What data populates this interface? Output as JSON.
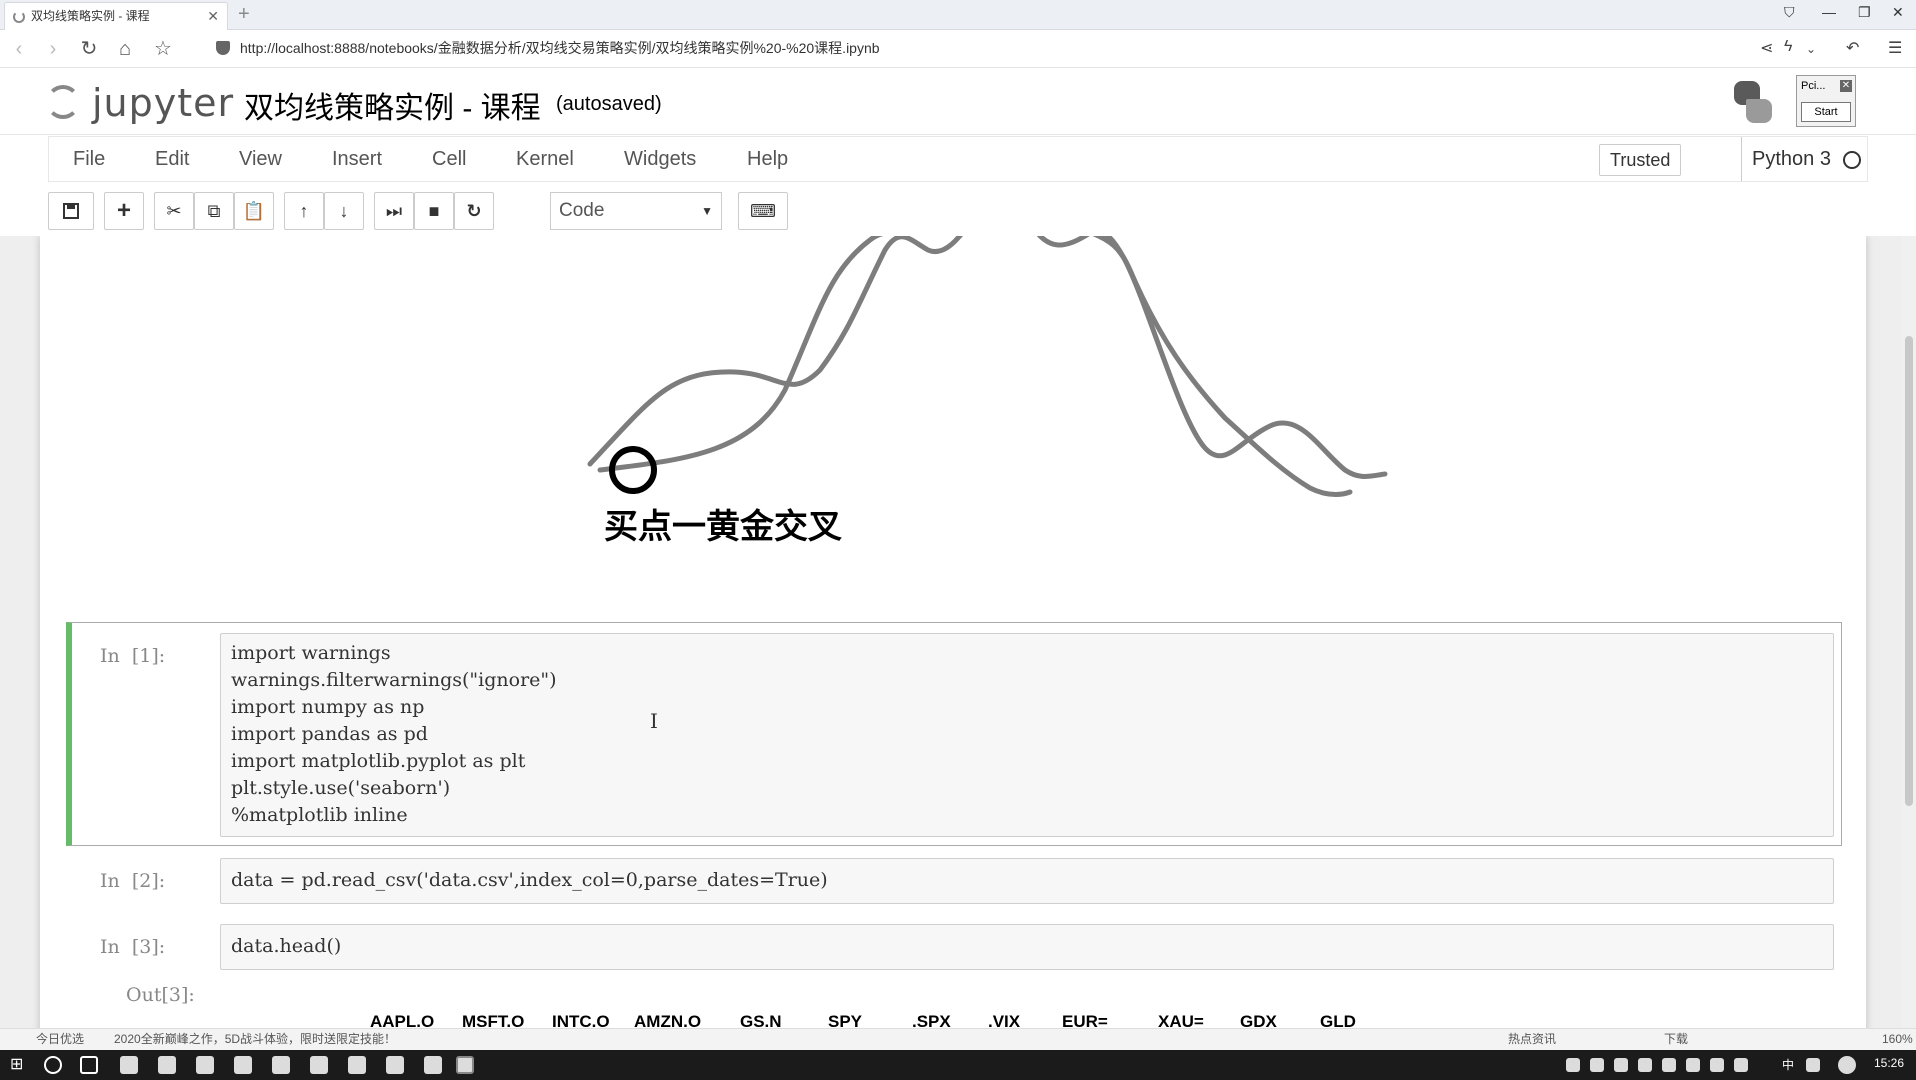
{
  "browser": {
    "tab_title": "双均线策略实例 - 课程",
    "url": "http://localhost:8888/notebooks/金融数据分析/双均线交易策略实例/双均线策略实例%20-%20课程.ipynb"
  },
  "jupyter": {
    "logo_text": "jupyter",
    "notebook_title": "双均线策略实例 - 课程",
    "autosave_status": "(autosaved)",
    "popup": {
      "title": "Pci...",
      "start_label": "Start"
    }
  },
  "menu": {
    "items": [
      "File",
      "Edit",
      "View",
      "Insert",
      "Cell",
      "Kernel",
      "Widgets",
      "Help"
    ],
    "trusted": "Trusted",
    "kernel": "Python 3"
  },
  "toolbar": {
    "cell_type": "Code"
  },
  "figure": {
    "annotation": "买点一黄金交叉"
  },
  "cells": [
    {
      "prompt": "In  [1]:",
      "lines": [
        "import warnings",
        "warnings.filterwarnings(\"ignore\")",
        "import numpy as np",
        "import pandas as pd",
        "import matplotlib.pyplot as plt",
        "plt.style.use('seaborn')",
        "%matplotlib inline"
      ]
    },
    {
      "prompt": "In  [2]:",
      "lines": [
        "data = pd.read_csv('data.csv',index_col=0,parse_dates=True)"
      ]
    },
    {
      "prompt": "In  [3]:",
      "lines": [
        "data.head()"
      ]
    }
  ],
  "output": {
    "prompt": "Out[3]:",
    "columns": [
      "AAPL.O",
      "MSFT.O",
      "INTC.O",
      "AMZN.O",
      "GS.N",
      "SPY",
      ".SPX",
      ".VIX",
      "EUR=",
      "XAU=",
      "GDX",
      "GLD"
    ]
  },
  "statusbar": {
    "left1": "今日优选",
    "left2": "2020全新巅峰之作，5D战斗体验，限时送限定技能！",
    "right1": "热点资讯",
    "right2": "下载",
    "zoom": "160%"
  },
  "taskbar": {
    "ime": "中",
    "time": "15:26"
  }
}
